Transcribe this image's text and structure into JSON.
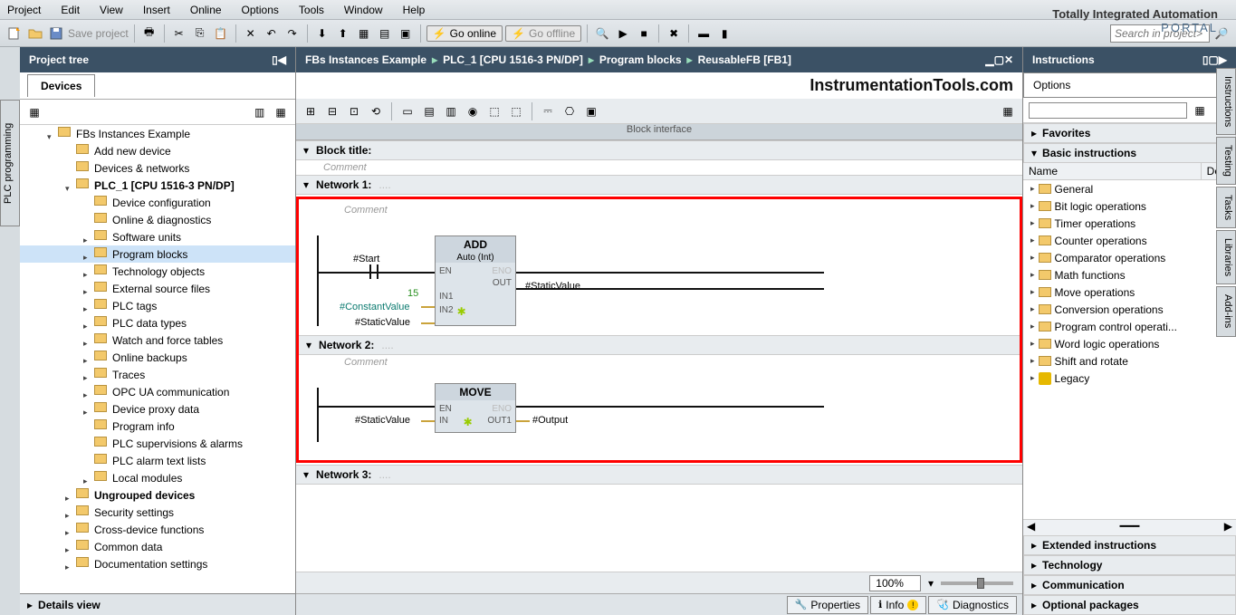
{
  "menu": {
    "items": [
      "Project",
      "Edit",
      "View",
      "Insert",
      "Online",
      "Options",
      "Tools",
      "Window",
      "Help"
    ]
  },
  "portal": {
    "line1": "Totally Integrated Automation",
    "line2": "PORTAL"
  },
  "toolbar": {
    "save": "Save project",
    "go_online": "Go online",
    "go_offline": "Go offline",
    "search_placeholder": "Search in project>"
  },
  "left_panel": {
    "title": "Project tree",
    "tab": "Devices",
    "vtab": "PLC programming"
  },
  "tree": {
    "root": "FBs Instances Example",
    "items": [
      {
        "label": "Add new device",
        "indent": 50
      },
      {
        "label": "Devices & networks",
        "indent": 50
      },
      {
        "label": "PLC_1 [CPU 1516-3 PN/DP]",
        "indent": 50,
        "tw": "o",
        "bold": true
      },
      {
        "label": "Device configuration",
        "indent": 70
      },
      {
        "label": "Online & diagnostics",
        "indent": 70
      },
      {
        "label": "Software units",
        "indent": 70,
        "tw": "c"
      },
      {
        "label": "Program blocks",
        "indent": 70,
        "tw": "c",
        "sel": true
      },
      {
        "label": "Technology objects",
        "indent": 70,
        "tw": "c"
      },
      {
        "label": "External source files",
        "indent": 70,
        "tw": "c"
      },
      {
        "label": "PLC tags",
        "indent": 70,
        "tw": "c"
      },
      {
        "label": "PLC data types",
        "indent": 70,
        "tw": "c"
      },
      {
        "label": "Watch and force tables",
        "indent": 70,
        "tw": "c"
      },
      {
        "label": "Online backups",
        "indent": 70,
        "tw": "c"
      },
      {
        "label": "Traces",
        "indent": 70,
        "tw": "c"
      },
      {
        "label": "OPC UA communication",
        "indent": 70,
        "tw": "c"
      },
      {
        "label": "Device proxy data",
        "indent": 70,
        "tw": "c"
      },
      {
        "label": "Program info",
        "indent": 70
      },
      {
        "label": "PLC supervisions & alarms",
        "indent": 70
      },
      {
        "label": "PLC alarm text lists",
        "indent": 70
      },
      {
        "label": "Local modules",
        "indent": 70,
        "tw": "c"
      },
      {
        "label": "Ungrouped devices",
        "indent": 50,
        "tw": "c",
        "bold": true
      },
      {
        "label": "Security settings",
        "indent": 50,
        "tw": "c"
      },
      {
        "label": "Cross-device functions",
        "indent": 50,
        "tw": "c"
      },
      {
        "label": "Common data",
        "indent": 50,
        "tw": "c"
      },
      {
        "label": "Documentation settings",
        "indent": 50,
        "tw": "c"
      }
    ]
  },
  "details": "Details view",
  "breadcrumb": [
    "FBs Instances Example",
    "PLC_1 [CPU 1516-3 PN/DP]",
    "Program blocks",
    "ReusableFB [FB1]"
  ],
  "watermark": "InstrumentationTools.com",
  "block_iface": "Block interface",
  "sections": {
    "block_title": "Block title:",
    "comment": "Comment",
    "net1": "Network 1:",
    "net2": "Network 2:",
    "net3": "Network 3:"
  },
  "net1": {
    "box_title": "ADD",
    "box_sub": "Auto (Int)",
    "en": "EN",
    "eno": "ENO",
    "out": "OUT",
    "in1": "IN1",
    "in2": "IN2",
    "start": "#Start",
    "const_val": "15",
    "const_lbl": "#ConstantValue",
    "static": "#StaticValue",
    "out_lbl": "#StaticValue"
  },
  "net2": {
    "box_title": "MOVE",
    "en": "EN",
    "eno": "ENO",
    "in": "IN",
    "out1": "OUT1",
    "in_lbl": "#StaticValue",
    "out_lbl": "#Output"
  },
  "zoom": "100%",
  "bottom_tabs": {
    "properties": "Properties",
    "info": "Info",
    "diagnostics": "Diagnostics"
  },
  "right": {
    "title": "Instructions",
    "options": "Options",
    "favorites": "Favorites",
    "basic": "Basic instructions",
    "cols": {
      "name": "Name",
      "de": "De..."
    },
    "items": [
      "General",
      "Bit logic operations",
      "Timer operations",
      "Counter operations",
      "Comparator operations",
      "Math functions",
      "Move operations",
      "Conversion operations",
      "Program control operati...",
      "Word logic operations",
      "Shift and rotate",
      "Legacy"
    ],
    "ext": "Extended instructions",
    "tech": "Technology",
    "comm": "Communication",
    "opt": "Optional packages"
  },
  "rtabs": [
    "Instructions",
    "Testing",
    "Tasks",
    "Libraries",
    "Add-ins"
  ]
}
